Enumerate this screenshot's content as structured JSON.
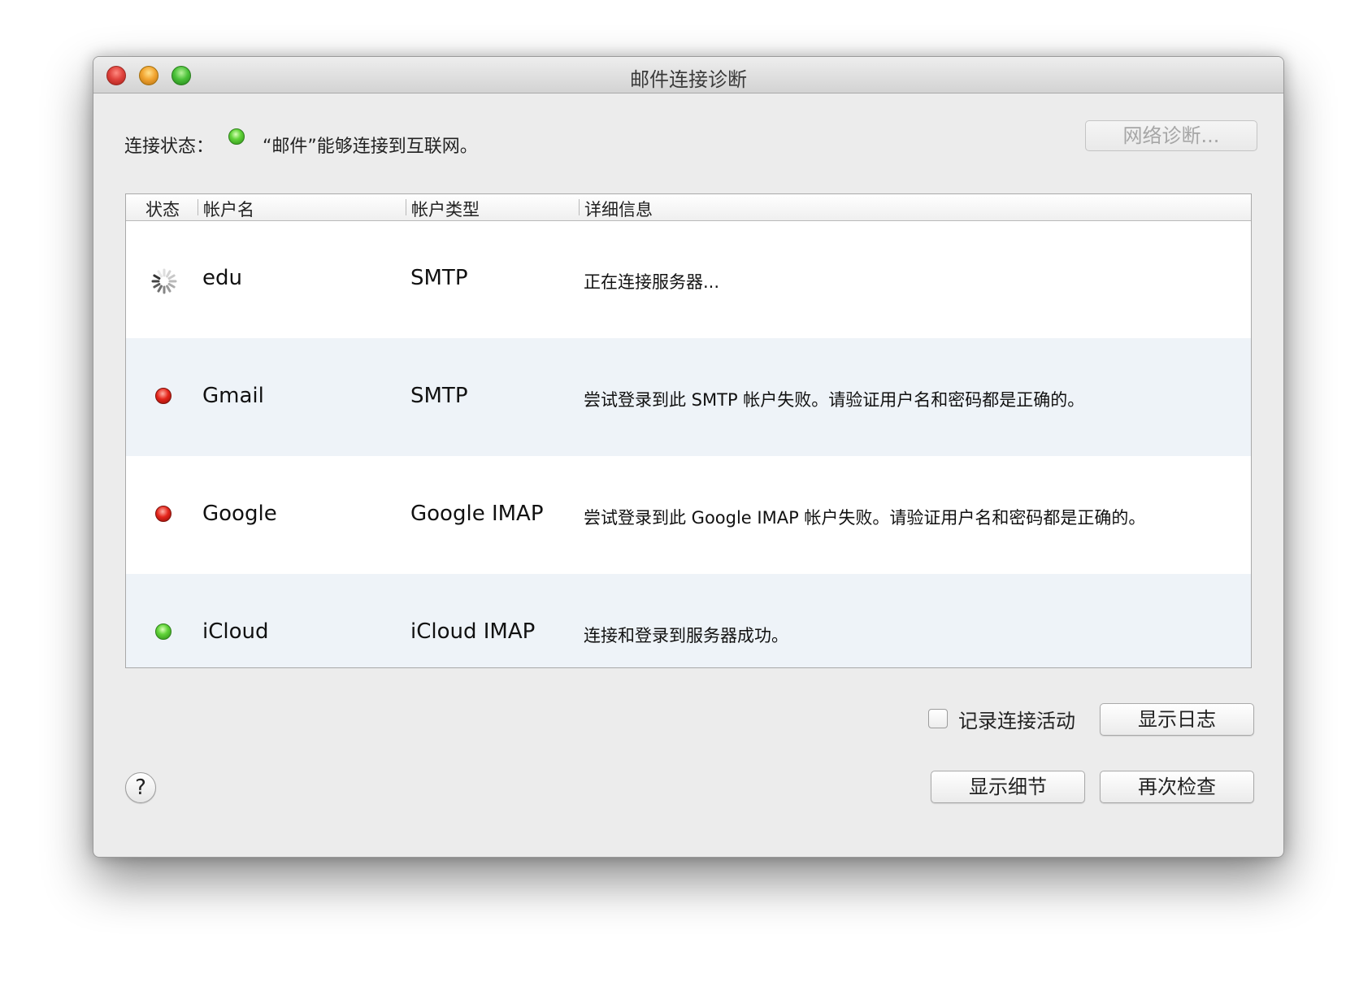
{
  "window": {
    "title": "邮件连接诊断"
  },
  "connection": {
    "label": "连接状态：",
    "status_color": "green",
    "status_text": "“邮件”能够连接到互联网。",
    "network_button": "网络诊断..."
  },
  "table": {
    "headers": {
      "status": "状态",
      "account": "帐户名",
      "type": "帐户类型",
      "details": "详细信息"
    },
    "rows": [
      {
        "status": "connecting",
        "status_icon": "spinner-icon",
        "name": "edu",
        "type": "SMTP",
        "detail": "正在连接服务器..."
      },
      {
        "status": "error",
        "status_icon": "red-status-icon",
        "name": "Gmail",
        "type": "SMTP",
        "detail": "尝试登录到此 SMTP 帐户失败。请验证用户名和密码都是正确的。"
      },
      {
        "status": "error",
        "status_icon": "red-status-icon",
        "name": "Google",
        "type": "Google IMAP",
        "detail": "尝试登录到此 Google IMAP 帐户失败。请验证用户名和密码都是正确的。"
      },
      {
        "status": "ok",
        "status_icon": "green-status-icon",
        "name": "iCloud",
        "type": "iCloud IMAP",
        "detail": "连接和登录到服务器成功。"
      }
    ]
  },
  "controls": {
    "log_checkbox_label": "记录连接活动",
    "log_checkbox_checked": false,
    "show_log": "显示日志",
    "show_details": "显示细节",
    "check_again": "再次检查",
    "help": "?"
  },
  "colors": {
    "window_bg": "#ececec",
    "row_alt_bg": "#eef3f8",
    "status_ok": "#4cc23a",
    "status_error": "#e5251b"
  }
}
